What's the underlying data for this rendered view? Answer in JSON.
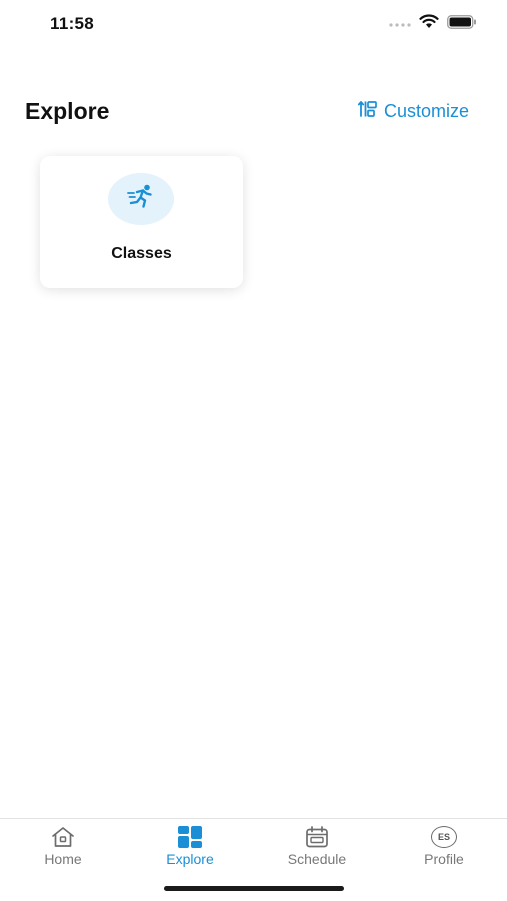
{
  "status_bar": {
    "time": "11:58"
  },
  "header": {
    "title": "Explore",
    "customize_label": "Customize"
  },
  "cards": [
    {
      "label": "Classes",
      "icon": "runner-icon"
    }
  ],
  "tab_bar": {
    "items": [
      {
        "label": "Home",
        "icon": "home-icon",
        "active": false
      },
      {
        "label": "Explore",
        "icon": "explore-grid-icon",
        "active": true
      },
      {
        "label": "Schedule",
        "icon": "calendar-icon",
        "active": false
      },
      {
        "label": "Profile",
        "icon": "avatar",
        "initials": "ES",
        "active": false
      }
    ]
  },
  "colors": {
    "accent": "#1a8fd6",
    "icon_circle": "#e4f2fb",
    "inactive": "#777777"
  }
}
